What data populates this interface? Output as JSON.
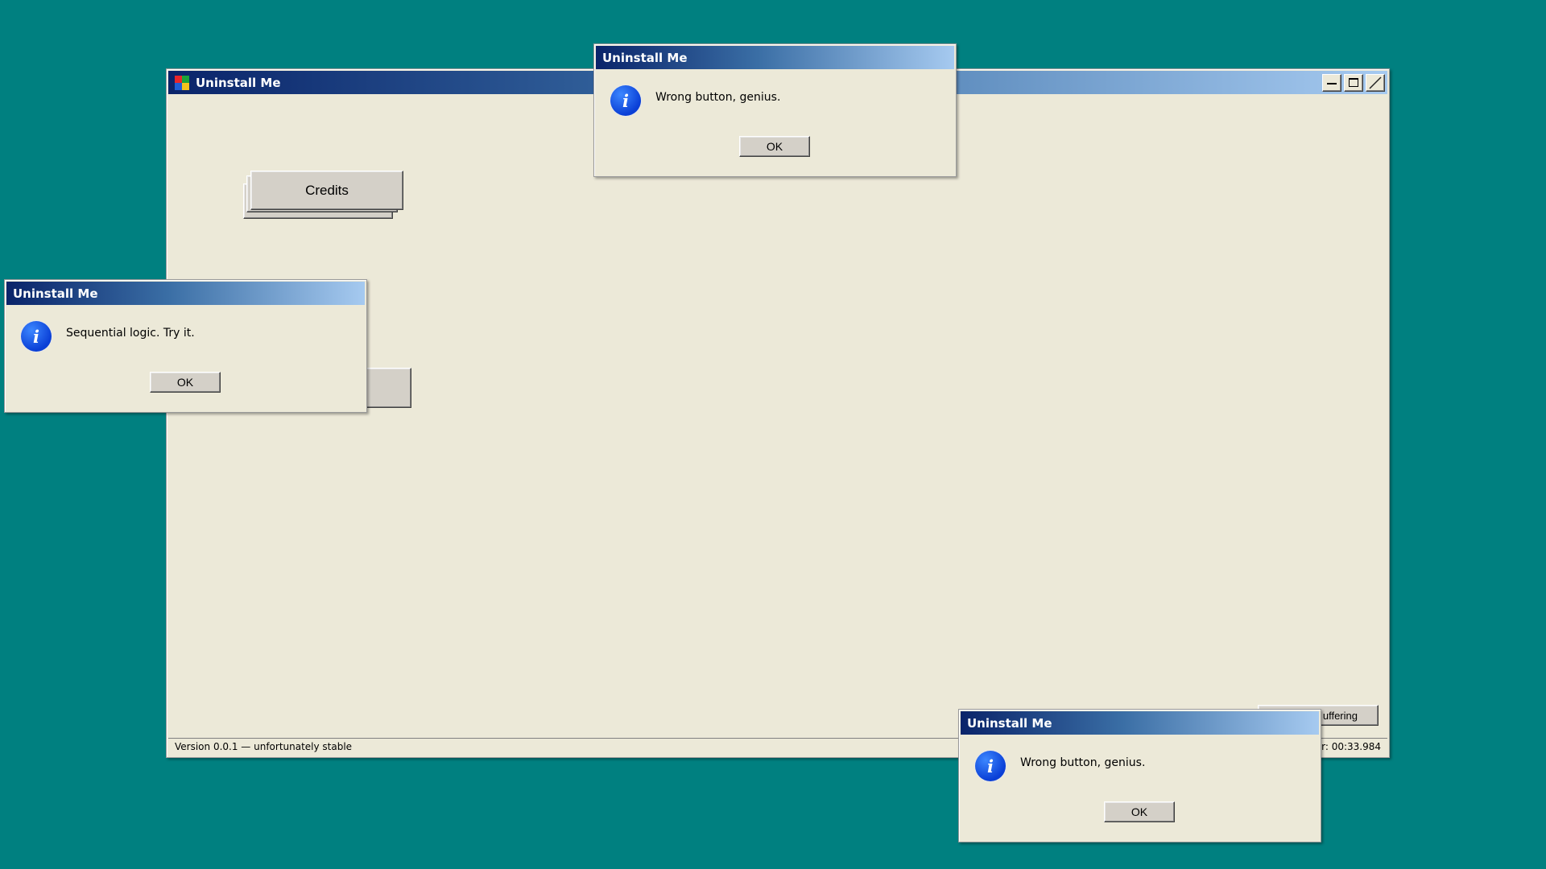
{
  "main_window": {
    "title": "Uninstall Me",
    "credits_label": "Credits",
    "hidden_button_label": "",
    "corner_button_label": "uffering",
    "status_left": "Version 0.0.1 — unfortunately stable",
    "status_right": "er: 00:33.984"
  },
  "dialogs": [
    {
      "title": "Uninstall Me",
      "message": "Wrong button, genius.",
      "ok_label": "OK"
    },
    {
      "title": "Uninstall Me",
      "message": "Sequential logic. Try it.",
      "ok_label": "OK"
    },
    {
      "title": "Uninstall Me",
      "message": "Wrong button, genius.",
      "ok_label": "OK"
    }
  ],
  "icons": {
    "dialog_icon": "info-icon",
    "dialog_icon_glyph": "i",
    "app_icon": "windows-logo-icon"
  },
  "colors": {
    "desktop": "#008080",
    "window_face": "#ECE9D8",
    "title_start": "#0A246A",
    "title_end": "#A6CAF0"
  }
}
